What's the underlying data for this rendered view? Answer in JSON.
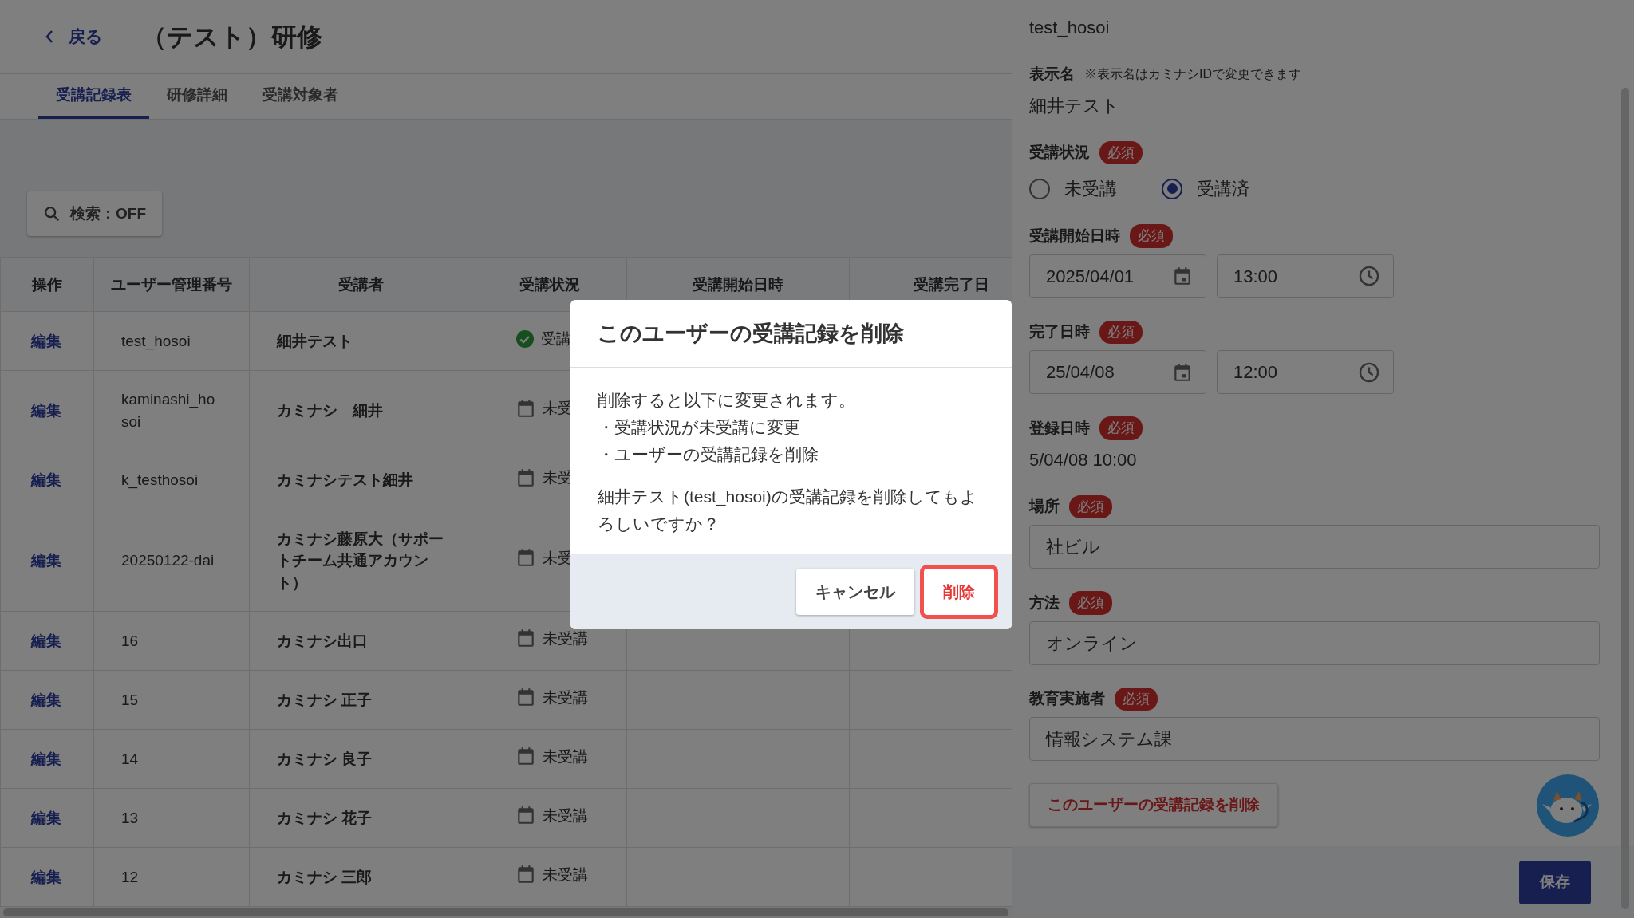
{
  "header": {
    "back": "戻る",
    "title": "（テスト）研修"
  },
  "tabs": [
    {
      "label": "受講記録表",
      "selected": true
    },
    {
      "label": "研修詳細",
      "selected": false
    },
    {
      "label": "受講対象者",
      "selected": false
    }
  ],
  "search_button": "検索：OFF",
  "table": {
    "columns": [
      "操作",
      "ユーザー管理番号",
      "受講者",
      "受講状況",
      "受講開始日時",
      "受講完了日"
    ],
    "rows": [
      {
        "action": "編集",
        "user_id": "test_hosoi",
        "name": "細井テスト",
        "status": {
          "kind": "done",
          "text": "受講"
        }
      },
      {
        "action": "編集",
        "user_id": "kaminashi_hosoi",
        "name": "カミナシ　細井",
        "status": {
          "kind": "pending",
          "text": "未受"
        }
      },
      {
        "action": "編集",
        "user_id": "k_testhosoi",
        "name": "カミナシテスト細井",
        "status": {
          "kind": "pending",
          "text": "未受"
        }
      },
      {
        "action": "編集",
        "user_id": "20250122-dai",
        "name": "カミナシ藤原大（サポートチーム共通アカウント）",
        "status": {
          "kind": "pending",
          "text": "未受"
        }
      },
      {
        "action": "編集",
        "user_id": "16",
        "name": "カミナシ出口",
        "status": {
          "kind": "pending",
          "text": "未受講"
        }
      },
      {
        "action": "編集",
        "user_id": "15",
        "name": "カミナシ 正子",
        "status": {
          "kind": "pending",
          "text": "未受講"
        }
      },
      {
        "action": "編集",
        "user_id": "14",
        "name": "カミナシ 良子",
        "status": {
          "kind": "pending",
          "text": "未受講"
        }
      },
      {
        "action": "編集",
        "user_id": "13",
        "name": "カミナシ 花子",
        "status": {
          "kind": "pending",
          "text": "未受講"
        }
      },
      {
        "action": "編集",
        "user_id": "12",
        "name": "カミナシ 三郎",
        "status": {
          "kind": "pending",
          "text": "未受講"
        }
      }
    ]
  },
  "panel": {
    "fields": [
      {
        "kind": "readonly",
        "value": "test_hosoi"
      },
      {
        "kind": "readonly",
        "label": "表示名",
        "note": "※表示名はカミナシIDで変更できます",
        "value": "細井テスト"
      },
      {
        "kind": "radio",
        "label": "受講状況",
        "badge": "必須",
        "options": [
          {
            "label": "未受講",
            "selected": false
          },
          {
            "label": "受講済",
            "selected": true
          }
        ]
      },
      {
        "kind": "datetime",
        "label": "受講開始日時",
        "badge": "必須",
        "date": "2025/04/01",
        "time": "13:00"
      },
      {
        "kind": "datetime",
        "label": "完了日時",
        "badge": "必須",
        "date": "25/04/08",
        "time": "12:00"
      },
      {
        "kind": "readonly",
        "label": "登録日時",
        "badge": "必須",
        "value": "5/04/08 10:00"
      },
      {
        "kind": "input",
        "label": "場所",
        "badge": "必須",
        "value": "社ビル"
      },
      {
        "kind": "input",
        "label": "方法",
        "badge": "必須",
        "value": "オンライン"
      },
      {
        "kind": "input",
        "label": "教育実施者",
        "badge": "必須",
        "value": "情報システム課"
      }
    ],
    "delete_button": "このユーザーの受講記録を削除",
    "save_button": "保存"
  },
  "dialog": {
    "title": "このユーザーの受講記録を削除",
    "lines": [
      "削除すると以下に変更されます。",
      "・受講状況が未受講に変更",
      "・ユーザーの受講記録を削除"
    ],
    "question": "細井テスト(test_hosoi)の受講記録を削除してもよろしいですか？",
    "buttons": [
      {
        "label": "キャンセル",
        "kind": "secondary",
        "focused": false
      },
      {
        "label": "削除",
        "kind": "danger",
        "focused": true
      }
    ]
  }
}
